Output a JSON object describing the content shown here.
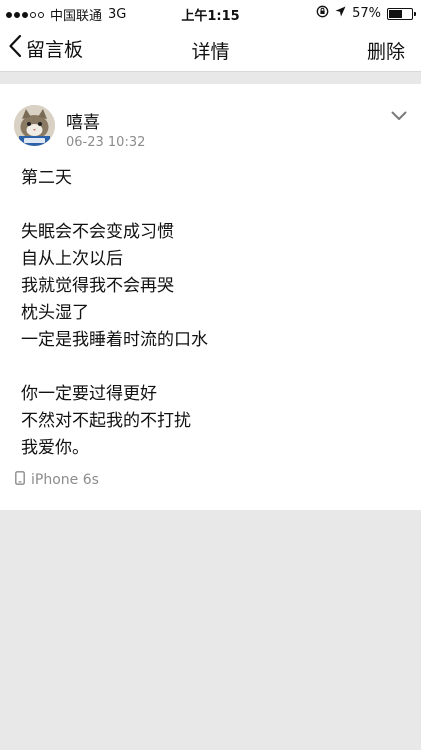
{
  "status_bar": {
    "carrier": "中国联通",
    "network": "3G",
    "time": "上午1:15",
    "battery": "57%",
    "battery_level": 0.57
  },
  "nav": {
    "back_label": "留言板",
    "title": "详情",
    "delete_label": "删除"
  },
  "post": {
    "author": "嘻喜",
    "time": "06-23 10:32",
    "lines": [
      "第二天",
      "",
      "失眠会不会变成习惯",
      "自从上次以后",
      "我就觉得我不会再哭",
      "枕头湿了",
      "一定是我睡着时流的口水",
      "",
      "你一定要过得更好",
      "不然对不起我的不打扰",
      "我爱你。"
    ],
    "device": "iPhone 6s"
  },
  "icons": {
    "back": "chevron-left-icon",
    "more": "chevron-down-icon",
    "device": "phone-icon",
    "orientation_lock": "orientation-lock-icon",
    "location": "location-arrow-icon",
    "battery": "battery-icon"
  },
  "colors": {
    "background": "#e8e8e8",
    "card": "#ffffff",
    "secondary_text": "#8c8c8c"
  }
}
